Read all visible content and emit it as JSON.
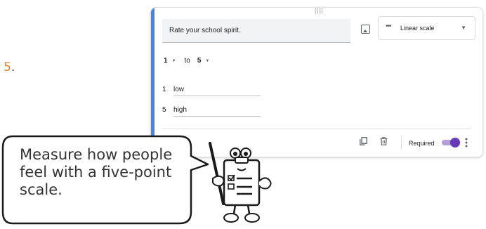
{
  "step": {
    "number": "5",
    "dot": "."
  },
  "question": {
    "title": "Rate your school spirit."
  },
  "question_type": {
    "label": "Linear scale"
  },
  "scale": {
    "min": "1",
    "max": "5",
    "to_label": "to",
    "min_label_num": "1",
    "min_label": "low",
    "max_label_num": "5",
    "max_label": "high"
  },
  "footer": {
    "required_label": "Required",
    "required_on": true
  },
  "callout": {
    "text": "Measure how people feel with a five-point scale."
  },
  "colors": {
    "accent": "#4285f4",
    "toggle": "#673ab7",
    "step_number": "#e8822a"
  },
  "icons": [
    "drag-handle-icon",
    "image-icon",
    "linear-scale-icon",
    "chevron-down-icon",
    "copy-icon",
    "trash-icon",
    "more-vert-icon"
  ]
}
